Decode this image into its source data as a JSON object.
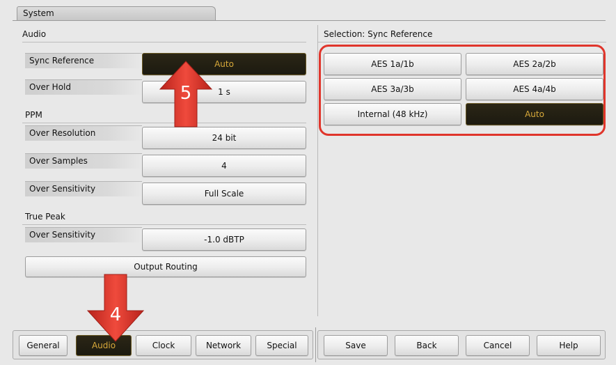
{
  "window": {
    "title": "System"
  },
  "left": {
    "audio_header": "Audio",
    "ppm_header": "PPM",
    "truepeak_header": "True Peak",
    "rows": [
      {
        "label": "Sync Reference",
        "value": "Auto"
      },
      {
        "label": "Over Hold",
        "value": "1 s"
      },
      {
        "label": "Over Resolution",
        "value": "24 bit"
      },
      {
        "label": "Over Samples",
        "value": "4"
      },
      {
        "label": "Over Sensitivity",
        "value": "Full Scale"
      },
      {
        "label": "Over Sensitivity",
        "value": "-1.0 dBTP"
      }
    ],
    "output_routing": "Output Routing"
  },
  "right": {
    "header": "Selection: Sync Reference",
    "options": [
      "AES 1a/1b",
      "AES 2a/2b",
      "AES 3a/3b",
      "AES 4a/4b",
      "Internal (48 kHz)",
      "Auto"
    ],
    "selected": "Auto"
  },
  "tabs": [
    "General",
    "Audio",
    "Clock",
    "Network",
    "Special"
  ],
  "active_tab": "Audio",
  "actions": [
    "Save",
    "Back",
    "Cancel",
    "Help"
  ],
  "annotations": {
    "arrow_up": "5",
    "arrow_down": "4"
  },
  "colors": {
    "selected_bg": "#1f1c12",
    "selected_text": "#d8a93a",
    "annotation": "#e0352b"
  }
}
